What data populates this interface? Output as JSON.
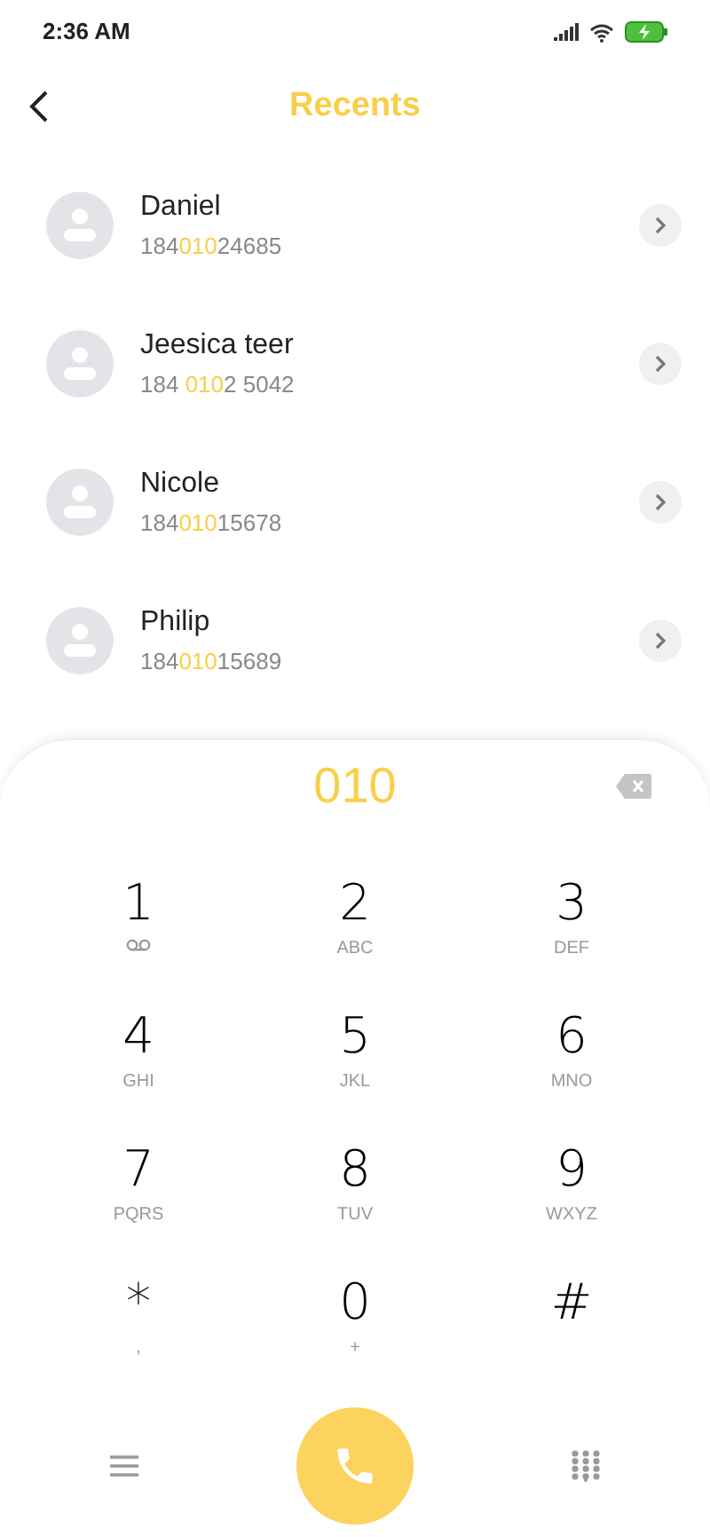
{
  "status_bar": {
    "time": "2:36 AM"
  },
  "header": {
    "title": "Recents"
  },
  "contacts": [
    {
      "name": "Daniel",
      "number": [
        {
          "text": "184",
          "highlight": false
        },
        {
          "text": "010",
          "highlight": true
        },
        {
          "text": "24685",
          "highlight": false
        }
      ]
    },
    {
      "name": "Jeesica teer",
      "number": [
        {
          "text": "184 ",
          "highlight": false
        },
        {
          "text": "010",
          "highlight": true
        },
        {
          "text": "2 5042",
          "highlight": false
        }
      ]
    },
    {
      "name": "Nicole",
      "number": [
        {
          "text": "184",
          "highlight": false
        },
        {
          "text": "010",
          "highlight": true
        },
        {
          "text": "15678",
          "highlight": false
        }
      ]
    },
    {
      "name": "Philip",
      "number": [
        {
          "text": "184",
          "highlight": false
        },
        {
          "text": "010",
          "highlight": true
        },
        {
          "text": "15689",
          "highlight": false
        }
      ]
    }
  ],
  "dialer": {
    "input": "010",
    "keys": [
      {
        "digit": "1",
        "kind": "voicemail"
      },
      {
        "digit": "2",
        "kind": "letters",
        "letters": "ABC"
      },
      {
        "digit": "3",
        "kind": "letters",
        "letters": "DEF"
      },
      {
        "digit": "4",
        "kind": "letters",
        "letters": "GHI"
      },
      {
        "digit": "5",
        "kind": "letters",
        "letters": "JKL"
      },
      {
        "digit": "6",
        "kind": "letters",
        "letters": "MNO"
      },
      {
        "digit": "7",
        "kind": "letters",
        "letters": "PQRS"
      },
      {
        "digit": "8",
        "kind": "letters",
        "letters": "TUV"
      },
      {
        "digit": "9",
        "kind": "letters",
        "letters": "WXYZ"
      },
      {
        "digit": "*",
        "kind": "letters",
        "letters": ","
      },
      {
        "digit": "0",
        "kind": "letters",
        "letters": "+"
      },
      {
        "digit": "#",
        "kind": "plain"
      }
    ]
  }
}
